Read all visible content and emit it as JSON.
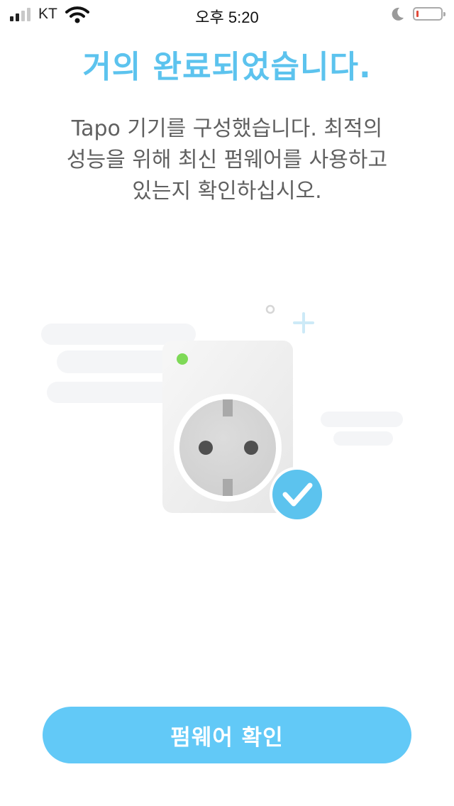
{
  "status_bar": {
    "carrier": "KT",
    "time": "오후 5:20"
  },
  "title": "거의 완료되었습니다.",
  "description_lines": [
    "Tapo 기기를 구성했습니다. 최적의",
    "성능을 위해 최신 펌웨어를 사용하고",
    "있는지 확인하십시오."
  ],
  "confirm_button_label": "펌웨어 확인",
  "colors": {
    "accent": "#5cc3ee",
    "button": "#62c9f7",
    "led": "#7ed957",
    "check_badge": "#5cc3ee"
  }
}
